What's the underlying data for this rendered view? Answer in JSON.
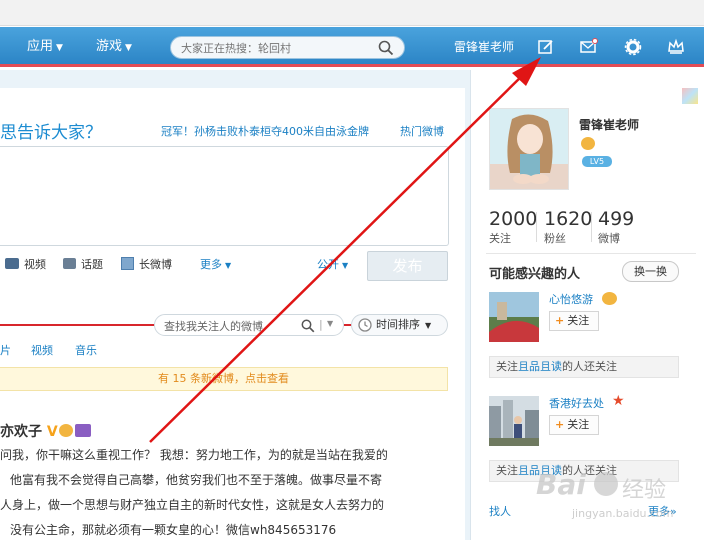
{
  "nav": {
    "items": [
      {
        "label": "应用"
      },
      {
        "label": "游戏"
      }
    ],
    "search_placeholder": "大家正在热搜：轮回村",
    "user_name": "雷锋崔老师"
  },
  "publisher": {
    "prompt": "思告诉大家？",
    "hot_topic": "冠军！孙杨击败朴泰桓夺400米自由泳金牌",
    "hot_link": "热门微博",
    "tools": [
      "视频",
      "话题",
      "长微博",
      "更多"
    ],
    "visibility": "公开",
    "publish_label": "发布"
  },
  "feed": {
    "search_placeholder": "查找我关注人的微博",
    "sort_label": "时间排序",
    "filter_tabs": [
      "片",
      "视频",
      "音乐"
    ],
    "notice": "有 15 条新微博，点击查看",
    "post": {
      "author": "亦欢子",
      "lines": [
        "问我，你干嘛这么重视工作？ 我想：努力地工作，为的就是当站在我爱的",
        "他富有我不会觉得自己高攀，他贫穷我们也不至于落魄。做事尽量不寄",
        "人身上，做一个思想与财产独立自主的新时代女性，这就是女人去努力的",
        "没有公主命，那就必须有一颗女皇的心！微信wh845653176"
      ]
    }
  },
  "profile": {
    "name": "雷锋崔老师",
    "level": "LV5",
    "stats": [
      {
        "num": "2000",
        "label": "关注"
      },
      {
        "num": "1620",
        "label": "粉丝"
      },
      {
        "num": "499",
        "label": "微博"
      }
    ]
  },
  "recommend": {
    "title": "可能感兴趣的人",
    "swap_label": "换一换",
    "follow_label": "关注",
    "people": [
      {
        "name": "心怡悠游",
        "also_prefix": "关注",
        "also_user": "且品且读",
        "also_suffix": "的人还关注"
      },
      {
        "name": "香港好去处",
        "also_prefix": "关注",
        "also_user": "且品且读",
        "also_suffix": "的人还关注"
      }
    ],
    "find_label": "找人",
    "more_label": "更多»"
  },
  "watermark": {
    "brand": "Bai",
    "brand2": "经验",
    "url": "jingyan.baidu.com"
  },
  "colors": {
    "nav_blue": "#3a95d4",
    "red_accent": "#d8262c",
    "link_blue": "#1b80c4"
  }
}
